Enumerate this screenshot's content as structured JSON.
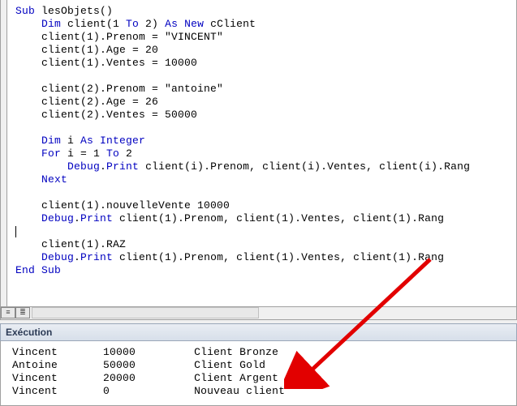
{
  "code": {
    "l1a": "Sub",
    "l1b": " lesObjets()",
    "l2a": "    Dim",
    "l2b": " client(1 ",
    "l2c": "To",
    "l2d": " 2) ",
    "l2e": "As New",
    "l2f": " cClient",
    "l3": "    client(1).Prenom = \"VINCENT\"",
    "l4": "    client(1).Age = 20",
    "l5": "    client(1).Ventes = 10000",
    "l6": "    ",
    "l7": "    client(2).Prenom = \"antoine\"",
    "l8": "    client(2).Age = 26",
    "l9": "    client(2).Ventes = 50000",
    "l10": "    ",
    "l11a": "    Dim",
    "l11b": " i ",
    "l11c": "As Integer",
    "l12a": "    For",
    "l12b": " i = 1 ",
    "l12c": "To",
    "l12d": " 2",
    "l13a": "        Debug",
    "l13b": ".",
    "l13c": "Print",
    "l13d": " client(i).Prenom, client(i).Ventes, client(i).Rang",
    "l14a": "    Next",
    "l15": "    ",
    "l16": "    client(1).nouvelleVente 10000",
    "l17a": "    Debug",
    "l17b": ".",
    "l17c": "Print",
    "l17d": " client(1).Prenom, client(1).Ventes, client(1).Rang",
    "l18": "    ",
    "l19": "    client(1).RAZ",
    "l20a": "    Debug",
    "l20b": ".",
    "l20c": "Print",
    "l20d": " client(1).Prenom, client(1).Ventes, client(1).Rang",
    "l21a": "End Sub"
  },
  "exec": {
    "title": "Exécution",
    "rows": [
      {
        "c1": "Vincent",
        "c2": "10000",
        "c3": "Client Bronze"
      },
      {
        "c1": "Antoine",
        "c2": "50000",
        "c3": "Client Gold"
      },
      {
        "c1": "Vincent",
        "c2": "20000",
        "c3": "Client Argent"
      },
      {
        "c1": "Vincent",
        "c2": "0",
        "c3": "Nouveau client"
      }
    ]
  },
  "icons": {
    "proc": "≡",
    "full": "≣"
  }
}
